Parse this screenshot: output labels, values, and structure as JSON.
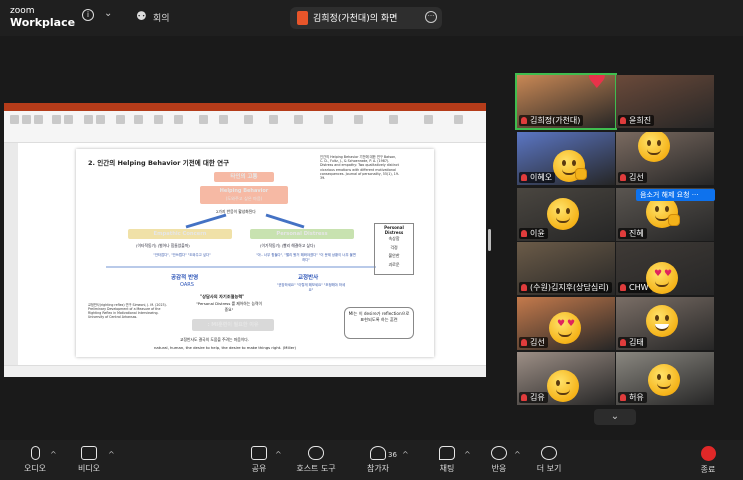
{
  "app": {
    "logo_line1": "zoom",
    "logo_line2": "Workplace"
  },
  "topbar": {
    "meeting_label": "회의",
    "share_label": "김희정(가천대)의 화면"
  },
  "slide": {
    "heading": "2. 인간의 Helping Behavior 기전에 대한 연구",
    "box1": "타인의 고통",
    "box2_title": "Helping Behavior",
    "box2_sub": "(도와주고 싶은 마음)",
    "mid_label": "2가지 반응이 활성화된다",
    "left_title": "Empathic Concern",
    "left_sub": "(이타적동기) (벌어나 힘들었을까)",
    "left_quote": "\"안타깝다\", \"안쓰럽다\" \"도와주고 싶다\"",
    "right_title": "Personal Distress",
    "right_sub": "(이기적동기) (빨리 해결하고 싶다)",
    "right_quote": "\"아.. 너무 힘들다\", \"빨리 봤거 해봐야겠다\" \"이 문제 상황이 너무 불편하다\"",
    "distress_box": [
      "Personal Distress",
      "속상함",
      "걱정",
      "불안한",
      "괴로운"
    ],
    "ref_right": "인간의 Helping Behavior 기전에 대한 연구 Batson, C. D., Fultz, J., & Schoenrade, P. A. (1987). Distress and empathy: Two qualitatively distinct vicarious emotions with different motivational consequences. Journal of personality, 55(1), 19-39.",
    "left_blue_1": "공감적 반영",
    "left_blue_2": "OARS",
    "right_blue_1": "교정반사",
    "right_blue_2": "\"권장하세요\" \"이렇게 해보세요\" \"조정해야 하세요\"",
    "center_quote_1": "\"상담사의 자기조절능력\"",
    "center_quote_2": "\"Personal Distress 를 제어하는 능력이 중요\"",
    "center_box": ": MI훈련이 필요한 이유",
    "ref_left": "교정반사(righting reflex) 연구 Simeoni, J. M. (2023). Preliminary Development of a Measure of the Righting Reflex in Motivational Interviewing. University of Central Arkansas.",
    "callout": "MI는 이 desire가 reflection으로 표현되도록 하는 훈련",
    "footer_kr": "교정반사도 결국의 도움을 주려는 마음이다.",
    "footer_en": "natural, human, the desire to help, the desire to make things right. (Miller)"
  },
  "gallery": {
    "tiles": [
      {
        "name": "김희정(가천대)",
        "color": "#c98855"
      },
      {
        "name": "윤희진",
        "color": "#6b4a3a"
      },
      {
        "name": "이혜오",
        "color": "#5b76c4"
      },
      {
        "name": "김선",
        "color": "#7a6a60"
      },
      {
        "name": "이윤",
        "color": "#4a4640"
      },
      {
        "name": "진혜",
        "color": "#5a5550"
      },
      {
        "name": "(수원)김지후(상담심리)",
        "color": "#6b5b48"
      },
      {
        "name": "CHW",
        "color": "#3f3a36"
      },
      {
        "name": "김선",
        "color": "#c47a4c"
      },
      {
        "name": "김태",
        "color": "#7a6e66"
      },
      {
        "name": "김유",
        "color": "#9d8f86"
      },
      {
        "name": "허유",
        "color": "#8a8780"
      }
    ],
    "hover_label": "음소거 해제 요청 ···"
  },
  "toolbar": {
    "audio": "오디오",
    "video": "비디오",
    "share": "공유",
    "host_tools": "호스트 도구",
    "participants": "참가자",
    "participants_count": "36",
    "chat": "채팅",
    "reactions": "반응",
    "more": "더 보기",
    "end": "종료"
  },
  "colors": {
    "accent": "#0e72ed",
    "end": "#e02828",
    "mute": "#e03c3c",
    "orange": "#f0a050",
    "green_box": "#c8e2b0",
    "pink_box": "#f6b9a4"
  }
}
